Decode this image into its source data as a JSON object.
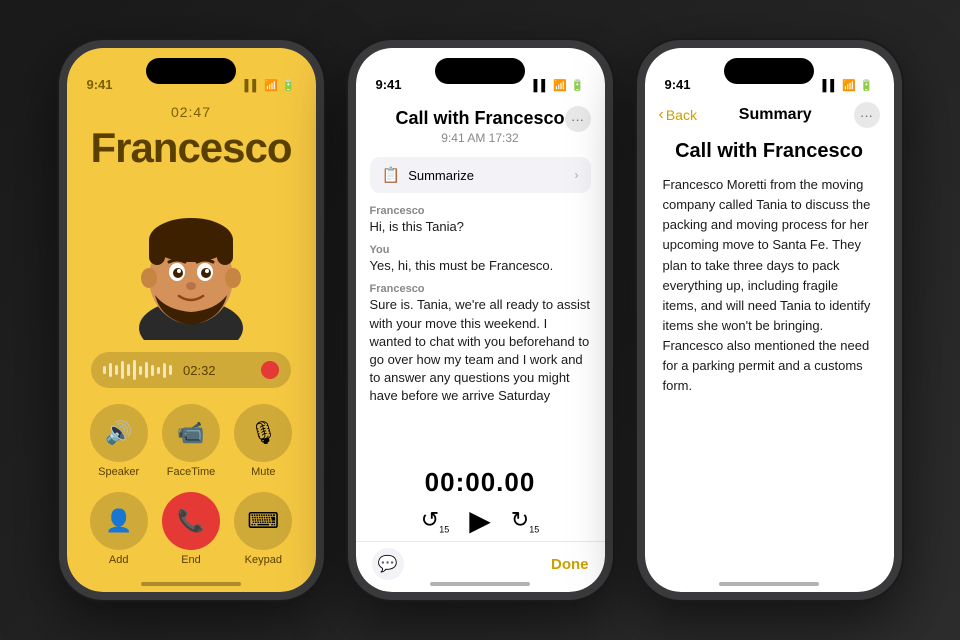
{
  "phone1": {
    "status_time": "9:41",
    "status_icons": "▌▌ ᵴ ⊟",
    "call_timer": "02:47",
    "caller_name": "Francesco",
    "audio_duration": "02:32",
    "controls": [
      {
        "icon": "🔊",
        "label": "Speaker"
      },
      {
        "icon": "📹",
        "label": "FaceTime"
      },
      {
        "icon": "🎙",
        "label": "Mute"
      }
    ],
    "controls2": [
      {
        "icon": "👤",
        "label": "Add"
      },
      {
        "icon": "📞",
        "label": "End",
        "red": true
      },
      {
        "icon": "⌨",
        "label": "Keypad"
      }
    ]
  },
  "phone2": {
    "status_time": "9:41",
    "title": "Call with Francesco",
    "subtitle": "9:41 AM  17:32",
    "summarize_label": "Summarize",
    "messages": [
      {
        "sender": "Francesco",
        "text": "Hi, is this Tania?"
      },
      {
        "sender": "You",
        "text": "Yes, hi, this must be Francesco."
      },
      {
        "sender": "Francesco",
        "text": "Sure is. Tania, we're all ready to assist with your move this weekend. I wanted to chat with you beforehand to go over how my team and I work and to answer any questions you might have before we arrive Saturday"
      }
    ],
    "playback_time": "00:00.00",
    "done_label": "Done"
  },
  "phone3": {
    "status_time": "9:41",
    "back_label": "Back",
    "nav_title": "Summary",
    "title": "Call with Francesco",
    "summary_text": "Francesco Moretti from the moving company called Tania to discuss the packing and moving process for her upcoming move to Santa Fe. They plan to take three days to pack everything up, including fragile items, and will need Tania to identify items she won't be bringing. Francesco also mentioned the need for a parking permit and a customs form."
  }
}
